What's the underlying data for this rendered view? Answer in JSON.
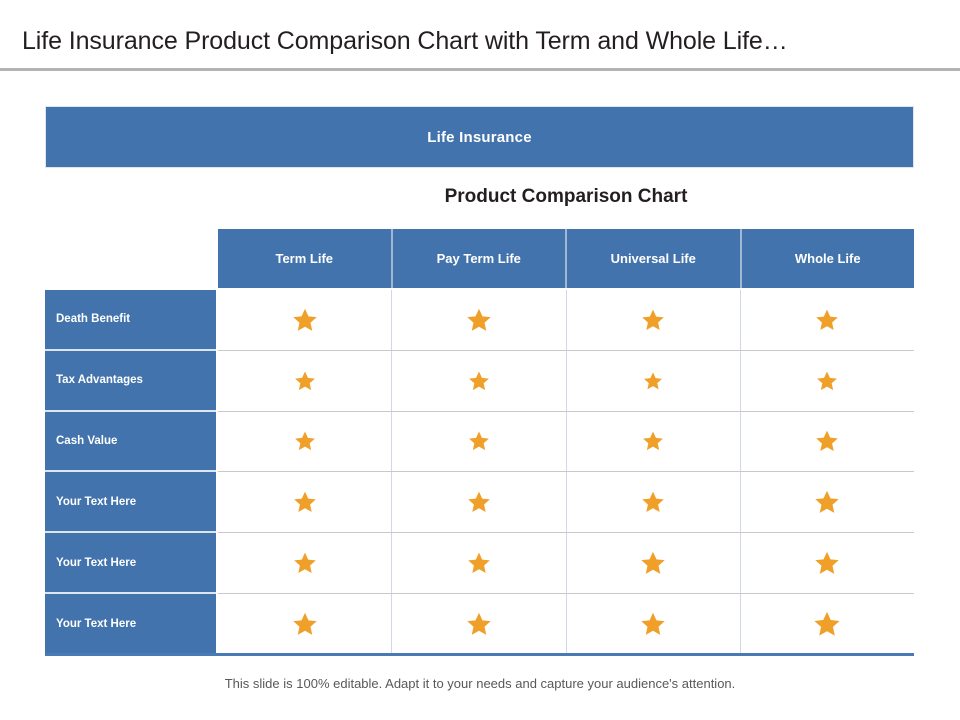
{
  "slide": {
    "title": "Life Insurance Product Comparison Chart with Term and Whole Life…",
    "banner_text": "Life Insurance",
    "subtitle": "Product Comparison Chart",
    "footer_note": "This slide is 100% editable. Adapt it to your needs and capture your audience's attention."
  },
  "colors": {
    "brand_blue": "#4273ac",
    "star_orange": "#f0a028",
    "divider_light_blue": "#9fb8d6",
    "cell_border": "#cfd8e4",
    "title_text": "#231f20",
    "footer_text": "#58595b",
    "banner_outline": "#dce6f1",
    "bottom_rule": "#4a7ab5"
  },
  "table": {
    "corner_label": "",
    "columns": [
      {
        "label": "Term Life"
      },
      {
        "label": "Pay Term Life"
      },
      {
        "label": "Universal Life"
      },
      {
        "label": "Whole Life"
      }
    ],
    "rows": [
      {
        "label": "Death Benefit",
        "cells": [
          {
            "icon": "star-icon"
          },
          {
            "icon": "star-icon"
          },
          {
            "icon": "star-icon"
          },
          {
            "icon": "star-icon"
          }
        ]
      },
      {
        "label": "Tax Advantages",
        "cells": [
          {
            "icon": "star-icon"
          },
          {
            "icon": "star-icon"
          },
          {
            "icon": "star-icon"
          },
          {
            "icon": "star-icon"
          }
        ]
      },
      {
        "label": "Cash Value",
        "cells": [
          {
            "icon": "star-icon"
          },
          {
            "icon": "star-icon"
          },
          {
            "icon": "star-icon"
          },
          {
            "icon": "star-icon"
          }
        ]
      },
      {
        "label": "Your Text Here",
        "cells": [
          {
            "icon": "star-icon"
          },
          {
            "icon": "star-icon"
          },
          {
            "icon": "star-icon"
          },
          {
            "icon": "star-icon"
          }
        ]
      },
      {
        "label": "Your Text Here",
        "cells": [
          {
            "icon": "star-icon"
          },
          {
            "icon": "star-icon"
          },
          {
            "icon": "star-icon"
          },
          {
            "icon": "star-icon"
          }
        ]
      },
      {
        "label": "Your Text Here",
        "cells": [
          {
            "icon": "star-icon"
          },
          {
            "icon": "star-icon"
          },
          {
            "icon": "star-icon"
          },
          {
            "icon": "star-icon"
          }
        ]
      }
    ]
  }
}
